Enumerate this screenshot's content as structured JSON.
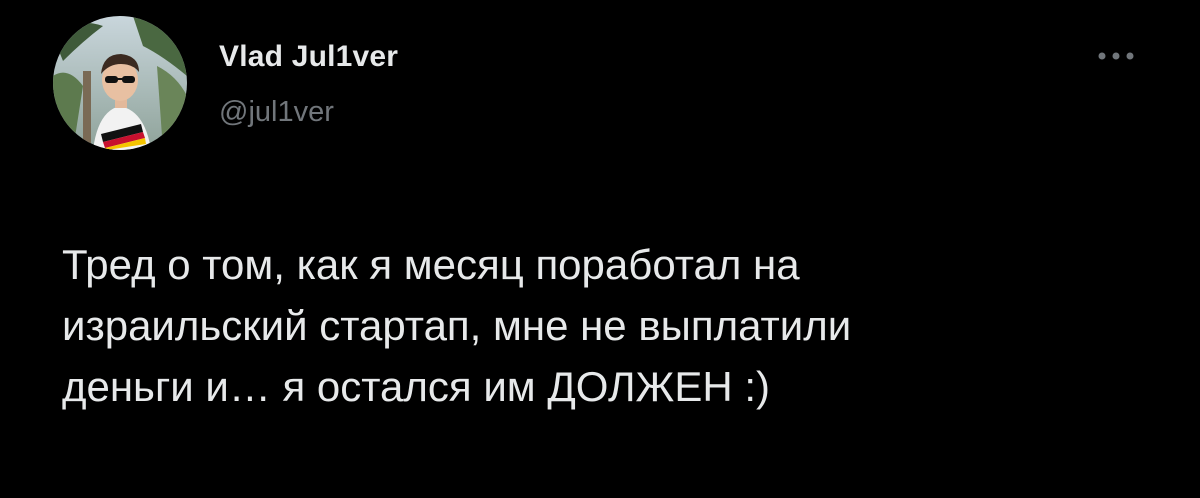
{
  "author": {
    "display_name": "Vlad Jul1ver",
    "handle": "@jul1ver",
    "avatar_icon": "profile-photo"
  },
  "header": {
    "more_icon": "more-horizontal-icon"
  },
  "tweet": {
    "text": "Тред о том, как я месяц поработал на\nизраильский стартап, мне не выплатили\nденьги и… я остался им ДОЛЖЕН :)"
  },
  "colors": {
    "background": "#000000",
    "primary_text": "#e7e9ea",
    "secondary_text": "#71767b"
  }
}
